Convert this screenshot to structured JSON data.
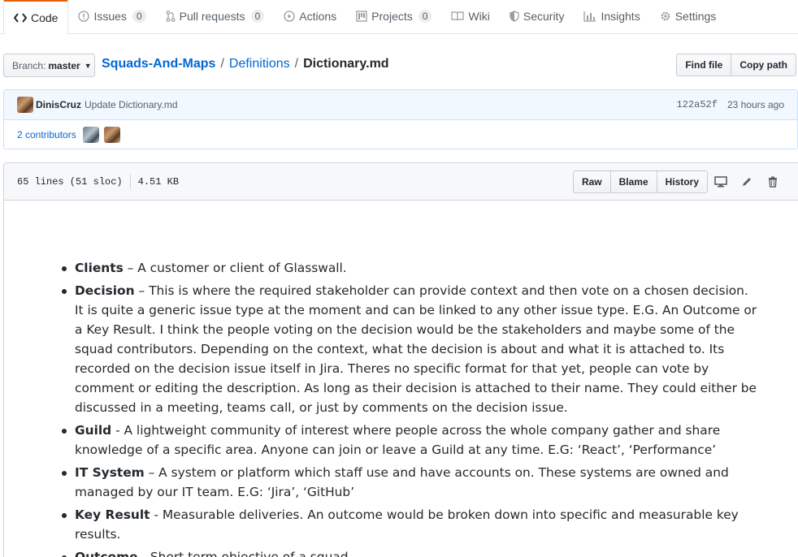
{
  "tabs": [
    {
      "label": "Code",
      "icon": "code-icon",
      "counter": null,
      "selected": true
    },
    {
      "label": "Issues",
      "icon": "issue-icon",
      "counter": "0"
    },
    {
      "label": "Pull requests",
      "icon": "pull-request-icon",
      "counter": "0"
    },
    {
      "label": "Actions",
      "icon": "play-icon",
      "counter": null
    },
    {
      "label": "Projects",
      "icon": "project-icon",
      "counter": "0"
    },
    {
      "label": "Wiki",
      "icon": "book-icon",
      "counter": null
    },
    {
      "label": "Security",
      "icon": "shield-icon",
      "counter": null
    },
    {
      "label": "Insights",
      "icon": "graph-icon",
      "counter": null
    },
    {
      "label": "Settings",
      "icon": "gear-icon",
      "counter": null
    }
  ],
  "branch": {
    "label": "Branch:",
    "value": "master"
  },
  "breadcrumb": {
    "repo": "Squads-And-Maps",
    "folder": "Definitions",
    "file": "Dictionary.md",
    "sep": "/"
  },
  "header_buttons": {
    "find_file": "Find file",
    "copy_path": "Copy path"
  },
  "commit": {
    "author": "DinisCruz",
    "message": "Update Dictionary.md",
    "sha": "122a52f",
    "time": "23 hours ago",
    "contributors": "2 contributors"
  },
  "file": {
    "lines": "65 lines (51 sloc)",
    "size": "4.51 KB",
    "raw": "Raw",
    "blame": "Blame",
    "history": "History"
  },
  "items": [
    {
      "term": "Clients",
      "text": " – A customer or client of Glasswall."
    },
    {
      "term": "Decision",
      "text": " – This is where the required stakeholder can provide context and then vote on a chosen decision. It is quite a generic issue type at the moment and can be linked to any other issue type. E.G. An Outcome or a Key Result. I think the people voting on the decision would be the stakeholders and maybe some of the squad contributors. Depending on the context, what the decision is about and what it is attached to. Its recorded on the decision issue itself in Jira. Theres no specific format for that yet, people can vote by comment or editing the description. As long as their decision is attached to their name. They could either be discussed in a meeting, teams call, or just by comments on the decision issue."
    },
    {
      "term": "Guild",
      "text": " - A lightweight community of interest where people across the whole company gather and share knowledge of a specific area. Anyone can join or leave a Guild at any time. E.G: ‘React’, ‘Performance’"
    },
    {
      "term": "IT System",
      "text": " – A system or platform which staff use and have accounts on. These systems are owned and managed by our IT team. E.G: ‘Jira’, ‘GitHub’"
    },
    {
      "term": "Key Result",
      "text": " - Measurable deliveries. An outcome would be broken down into specific and measurable key results."
    },
    {
      "term": "Outcome",
      "text": " - Short term objective of a squad."
    }
  ]
}
